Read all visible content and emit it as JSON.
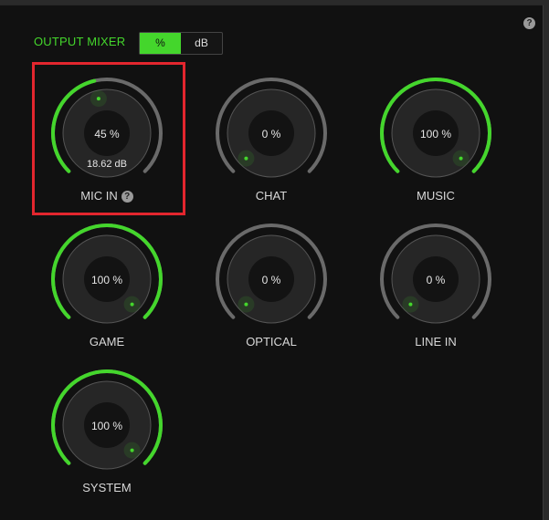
{
  "header": {
    "title": "OUTPUT MIXER",
    "help_icon": "question-circle-icon",
    "help_glyph": "?"
  },
  "unit_toggle": {
    "options": [
      "%",
      "dB"
    ],
    "selected": "%"
  },
  "colors": {
    "accent": "#44d62c",
    "track": "#6a6a6a",
    "highlight": "#e3262e"
  },
  "knobs": [
    {
      "label": "MIC IN",
      "value": 45,
      "display": "45 %",
      "sub": "18.62 dB",
      "help": true
    },
    {
      "label": "CHAT",
      "value": 0,
      "display": "0 %"
    },
    {
      "label": "MUSIC",
      "value": 100,
      "display": "100 %"
    },
    {
      "label": "GAME",
      "value": 100,
      "display": "100 %"
    },
    {
      "label": "OPTICAL",
      "value": 0,
      "display": "0 %"
    },
    {
      "label": "LINE IN",
      "value": 0,
      "display": "0 %"
    },
    {
      "label": "SYSTEM",
      "value": 100,
      "display": "100 %"
    }
  ]
}
